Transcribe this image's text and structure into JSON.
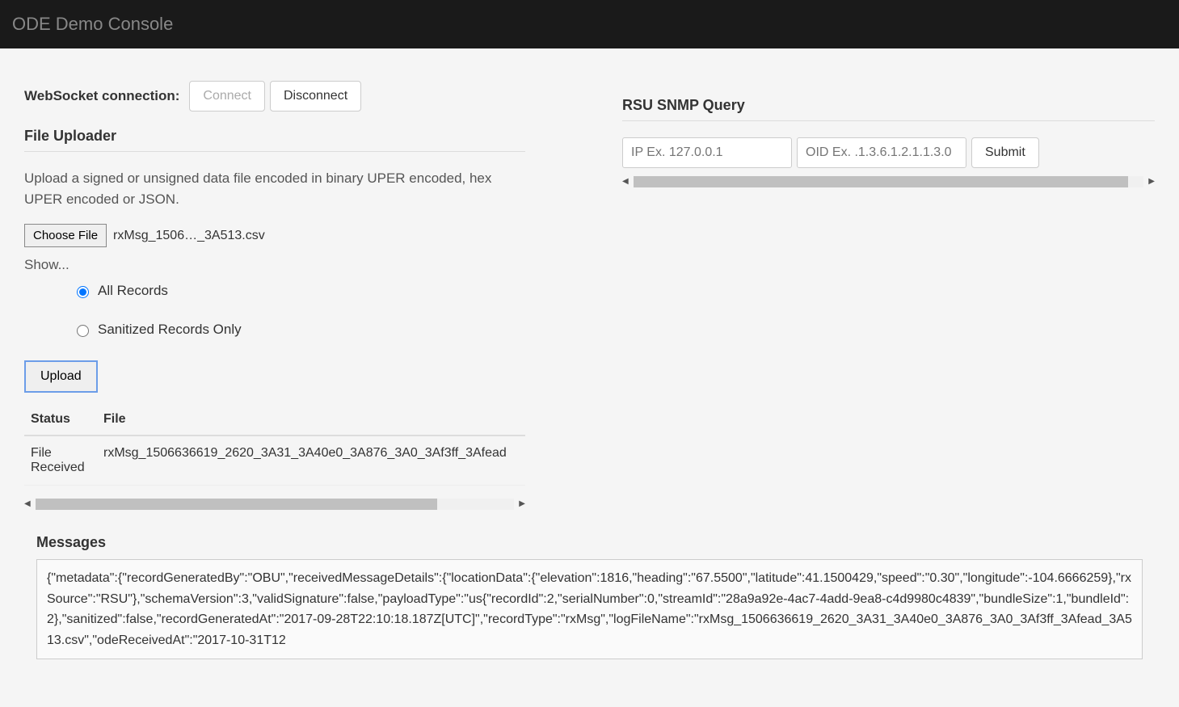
{
  "navbar": {
    "brand": "ODE Demo Console"
  },
  "websocket": {
    "label": "WebSocket connection:",
    "connect_label": "Connect",
    "disconnect_label": "Disconnect"
  },
  "uploader": {
    "title": "File Uploader",
    "help_text": "Upload a signed or unsigned data file encoded in binary UPER encoded, hex UPER encoded or JSON.",
    "choose_file_label": "Choose File",
    "chosen_file_name": "rxMsg_1506…_3A513.csv",
    "show_label": "Show...",
    "radio_all": "All Records",
    "radio_sanitized": "Sanitized Records Only",
    "upload_label": "Upload",
    "table": {
      "headers": [
        "Status",
        "File"
      ],
      "rows": [
        {
          "status": "File Received",
          "file": "rxMsg_1506636619_2620_3A31_3A40e0_3A876_3A0_3Af3ff_3Afead"
        }
      ]
    }
  },
  "snmp": {
    "title": "RSU SNMP Query",
    "ip_placeholder": "IP Ex. 127.0.0.1",
    "oid_placeholder": "OID Ex. .1.3.6.1.2.1.1.3.0",
    "submit_label": "Submit"
  },
  "messages": {
    "title": "Messages",
    "content": "{\"metadata\":{\"recordGeneratedBy\":\"OBU\",\"receivedMessageDetails\":{\"locationData\":{\"elevation\":1816,\"heading\":\"67.5500\",\"latitude\":41.1500429,\"speed\":\"0.30\",\"longitude\":-104.6666259},\"rxSource\":\"RSU\"},\"schemaVersion\":3,\"validSignature\":false,\"payloadType\":\"us{\"recordId\":2,\"serialNumber\":0,\"streamId\":\"28a9a92e-4ac7-4add-9ea8-c4d9980c4839\",\"bundleSize\":1,\"bundleId\":2},\"sanitized\":false,\"recordGeneratedAt\":\"2017-09-28T22:10:18.187Z[UTC]\",\"recordType\":\"rxMsg\",\"logFileName\":\"rxMsg_1506636619_2620_3A31_3A40e0_3A876_3A0_3Af3ff_3Afead_3A513.csv\",\"odeReceivedAt\":\"2017-10-31T12"
  }
}
